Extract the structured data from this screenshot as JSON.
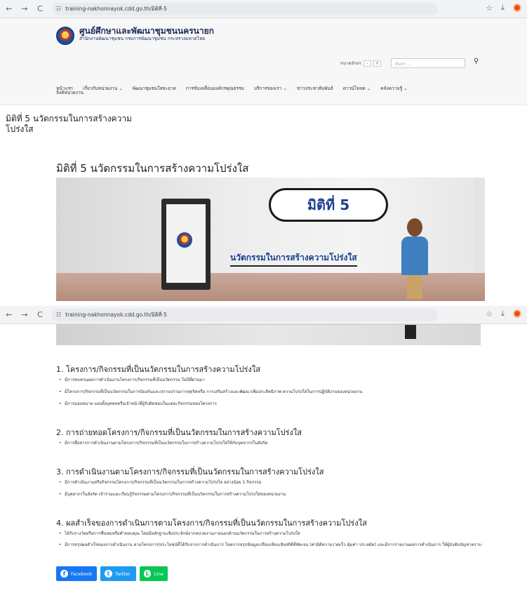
{
  "browser": {
    "url": "training-nakhonnayok.cdd.go.th/มิติที่-5",
    "back_icon": "←",
    "forward_icon": "→",
    "reload_icon": "C"
  },
  "header": {
    "site_title": "ศูนย์ศึกษาและพัฒนาชุมชนนครนายก",
    "site_subtitle": "สำนักงานพัฒนาชุมชน กรมการพัฒนาชุมชน กระทรวงมหาดไทย",
    "font_size_label": "ขนาดอักษร",
    "font_minus": "-",
    "font_plus": "+",
    "search_placeholder": "ค้นหา ..."
  },
  "menu": {
    "items": [
      "หน้าแรก",
      "เกี่ยวกับหน่วยงาน ⌄",
      "พัฒนาชุมชนใสสะอาด",
      "การขับเคลื่อนองค์กรคุณธรรม",
      "บริการของเรา ⌄",
      "ข่าวประชาสัมพันธ์",
      "ดาวน์โหลด ⌄",
      "คลังความรู้ ⌄"
    ],
    "second_row": "ลิงค์หน่วยงาน"
  },
  "page": {
    "side_title": "มิติที่ 5 นวัตกรรมในการสร้างความโปร่งใส",
    "heading": "มิติที่ 5 นวัตกรรมในการสร้างความโปร่งใส",
    "banner_bubble": "มิติที่ 5",
    "banner_tagline": "นวัตกรรมในการสร้างความโปร่งใส"
  },
  "sections": [
    {
      "title": "1. โครงการ/กิจกรรมที่เป็นนวัตกรรมในการสร้างความโปร่งใส",
      "bullets": [
        "มีการทบทวนผลการดำเนินงานโครงการ/กิจกรรมที่เป็นนวัตกรรม ในปีที่ผ่านมา",
        "มีโครงการ/กิจกรรมที่เป็นนวัตกรรมในการป้องกันและปราบปรามการทุจริตหรือ การเสริมสร้างและพัฒนาเพิ่มประสิทธิภาพ ความโปร่งใสในการปฏิบัติงานของหน่วยงาน",
        "มีการมอบหมาย แต่งตั้งบุคคลหรือเจ้าหน้าที่ผู้รับผิดชอบในแต่ละกิจกรรมของโครงการ"
      ]
    },
    {
      "title": "2. การถ่ายทอดโครงการ/กิจกรรมที่เป็นนวัตกรรมในการสร้างความโปร่งใส",
      "bullets": [
        "มีการสื่อสารการดำเนินงานตามโครงการ/กิจกรรมที่เป็นนวัตกรรมในการสร้างความโปร่งใสให้กับบุคลากรในสังกัด"
      ]
    },
    {
      "title": "3. การดำเนินงานตามโครงการ/กิจกรรมที่เป็นนวัตกรรมในการสร้างความโปร่งใส",
      "bullets": [
        "มีการดำเนินงานหรือกิจกรรมโครงการ/กิจกรรมที่เป็นนวัตกรรมในการสร้างความโปร่งใส อย่างน้อย 1 กิจกรรม",
        "มีบุคลากรในสังกัด เข้าร่วมและเรียนรู้กิจกรรมตามโครงการ/กิจกรรมที่เป็นนวัตกรรมในการสร้างความโปร่งใสของหน่วยงาน"
      ]
    },
    {
      "title": "4. ผลสำเร็จของการดำเนินการตามโครงการ/กิจกรรมที่เป็นนวัตกรรมในการสร้างความโปร่งใส",
      "bullets": [
        "ได้รับรางวัลหรือการชื่นชมหรือคำขอบคุณ โดยมีหลักฐานเชิงประจักษ์จากหน่วยงานภายนอกด้านนวัตกรรมในการสร้างความโปร่งใส",
        "มีการสรุปผลสำเร็จของการดำเนินงาน ตามโครงการ/ประโยชน์ที่ได้รับจากการดำเนินการ โดยการสรุปข้อมูลเปรียบเทียบเชิงสถิติที่ชัดเจน (ค่ามิติความรวดเร็ว คุ้มค่า ประหยัด) และมีการรายงานผลการดำเนินการ ให้ผู้บังคับบัญชาทราบ"
      ]
    }
  ],
  "share": {
    "facebook": "Facebook",
    "twitter": "Twitter",
    "line": "Line"
  },
  "colors": {
    "facebook": "#1877f2",
    "twitter": "#1d9bf0",
    "line": "#06c755",
    "brand_navy": "#1f2a5c"
  }
}
